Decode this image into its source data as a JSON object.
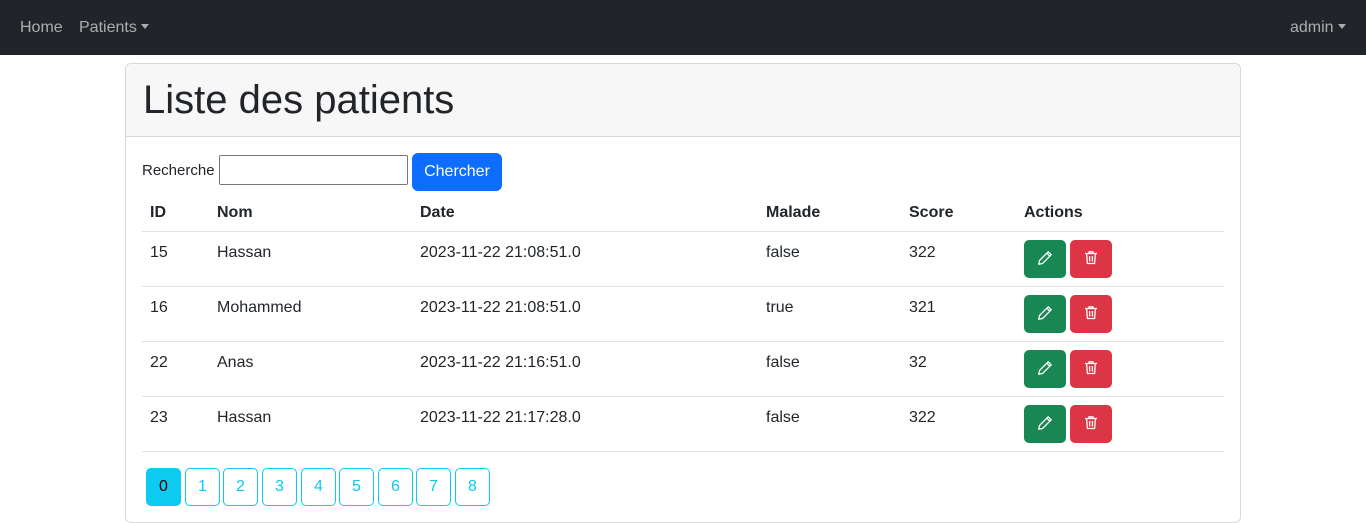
{
  "navbar": {
    "home_label": "Home",
    "patients_label": "Patients",
    "user_label": "admin"
  },
  "main": {
    "title": "Liste des patients",
    "search": {
      "label": "Recherche",
      "value": "",
      "button_label": "Chercher"
    },
    "table": {
      "columns": [
        "ID",
        "Nom",
        "Date",
        "Malade",
        "Score",
        "Actions"
      ],
      "rows": [
        {
          "id": "15",
          "nom": "Hassan",
          "date": "2023-11-22 21:08:51.0",
          "malade": "false",
          "score": "322"
        },
        {
          "id": "16",
          "nom": "Mohammed",
          "date": "2023-11-22 21:08:51.0",
          "malade": "true",
          "score": "321"
        },
        {
          "id": "22",
          "nom": "Anas",
          "date": "2023-11-22 21:16:51.0",
          "malade": "false",
          "score": "32"
        },
        {
          "id": "23",
          "nom": "Hassan",
          "date": "2023-11-22 21:17:28.0",
          "malade": "false",
          "score": "322"
        }
      ],
      "row_actions": {
        "edit_icon": "pencil-icon",
        "delete_icon": "trash-icon"
      }
    },
    "pagination": {
      "pages": [
        "0",
        "1",
        "2",
        "3",
        "4",
        "5",
        "6",
        "7",
        "8"
      ],
      "current": "0"
    }
  },
  "colors": {
    "navbar_bg": "#212529",
    "primary": "#0d6efd",
    "success": "#198754",
    "danger": "#dc3545",
    "info": "#0dcaf0"
  }
}
